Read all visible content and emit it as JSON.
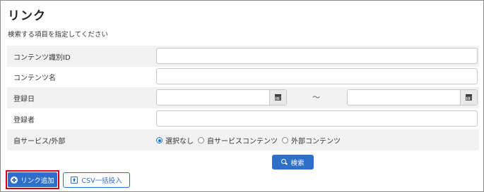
{
  "page": {
    "title": "リンク",
    "description": "検索する項目を指定してください"
  },
  "form": {
    "content_id_label": "コンテンツ識別ID",
    "content_id_value": "",
    "content_name_label": "コンテンツ名",
    "content_name_value": "",
    "reg_date_label": "登録日",
    "reg_date_from": "",
    "reg_date_to": "",
    "range_separator": "～",
    "registrant_label": "登録者",
    "registrant_value": "",
    "service_label": "自サービス/外部",
    "service_options": [
      "選択なし",
      "自サービスコンテンツ",
      "外部コンテンツ"
    ],
    "service_selected": "選択なし"
  },
  "actions": {
    "search_label": "検索",
    "add_link_label": "リンク追加",
    "csv_import_label": "CSV一括投入"
  },
  "colors": {
    "primary": "#2e6fc9",
    "highlight_border": "#d0021b",
    "row_shade": "#f2f2f2"
  }
}
